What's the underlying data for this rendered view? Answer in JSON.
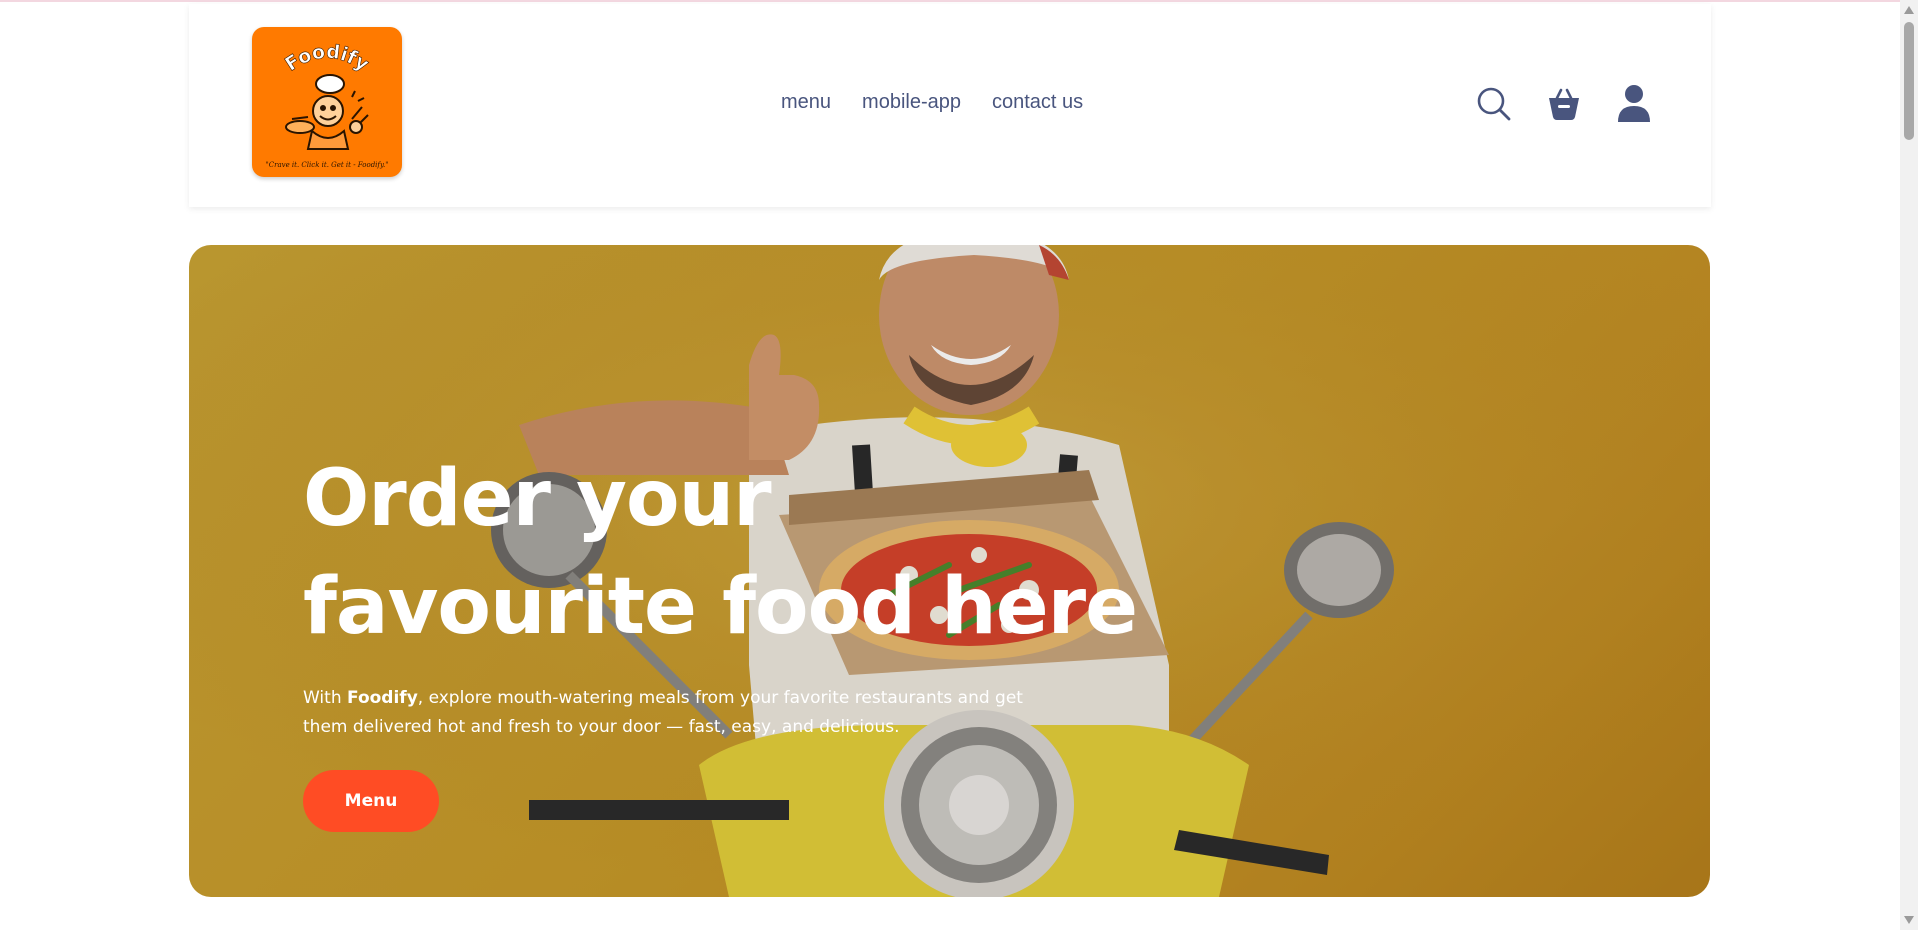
{
  "brand": {
    "name": "Foodify",
    "tagline": "\"Crave it. Click it. Get it - Foodify.\"",
    "logo_bg": "#ff7a00"
  },
  "nav": {
    "items": [
      {
        "label": "menu"
      },
      {
        "label": "mobile-app"
      },
      {
        "label": "contact us"
      }
    ],
    "color": "#49557e"
  },
  "header_icons": {
    "search": "search-icon",
    "basket": "basket-icon",
    "profile": "profile-icon"
  },
  "hero": {
    "title_line1": "Order your",
    "title_line2": "favourite food here",
    "desc_prefix": "With ",
    "desc_brand": "Foodify",
    "desc_suffix": ", explore mouth-watering meals from your favorite restaurants and get them delivered hot and fresh to your door — fast, easy, and delicious.",
    "button_label": "Menu",
    "button_color": "#ff4c24",
    "bg_color": "#c79a2a"
  }
}
